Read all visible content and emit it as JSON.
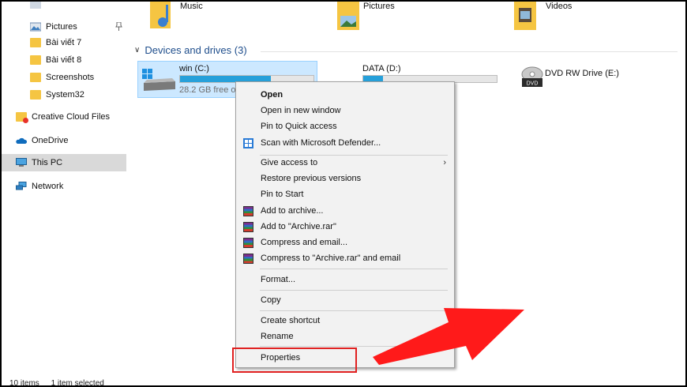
{
  "sidebar": {
    "items": [
      {
        "label": "Pictures",
        "pinned": true
      },
      {
        "label": "Bài viết 7"
      },
      {
        "label": "Bài viết 8"
      },
      {
        "label": "Screenshots"
      },
      {
        "label": "System32"
      },
      {
        "label": "Creative Cloud Files"
      },
      {
        "label": "OneDrive"
      },
      {
        "label": "This PC",
        "selected": true
      },
      {
        "label": "Network"
      }
    ]
  },
  "folders": [
    {
      "label": "Music"
    },
    {
      "label": "Pictures"
    },
    {
      "label": "Videos"
    }
  ],
  "group": {
    "label": "Devices and drives (3)"
  },
  "drives": [
    {
      "name": "win (C:)",
      "free_text": "28.2 GB free of",
      "used_fraction": 0.68
    },
    {
      "name": "DATA (D:)",
      "used_fraction": 0.15
    },
    {
      "name": "DVD RW Drive (E:)",
      "badge": "DVD"
    }
  ],
  "context_menu": {
    "items": [
      {
        "label": "Open",
        "bold": true
      },
      {
        "label": "Open in new window"
      },
      {
        "label": "Pin to Quick access"
      },
      {
        "label": "Scan with Microsoft Defender...",
        "icon": "defender-icon"
      },
      {
        "label": "Give access to",
        "submenu": true
      },
      {
        "label": "Restore previous versions"
      },
      {
        "label": "Pin to Start"
      },
      {
        "label": "Add to archive...",
        "icon": "winrar-icon"
      },
      {
        "label": "Add to \"Archive.rar\"",
        "icon": "winrar-icon"
      },
      {
        "label": "Compress and email...",
        "icon": "winrar-icon"
      },
      {
        "label": "Compress to \"Archive.rar\" and email",
        "icon": "winrar-icon"
      },
      {
        "label": "Format..."
      },
      {
        "label": "Copy"
      },
      {
        "label": "Create shortcut"
      },
      {
        "label": "Rename"
      },
      {
        "label": "Properties"
      }
    ],
    "submenu_glyph": "›"
  },
  "status_bar": {
    "items": "10 items",
    "selected": "1 item selected"
  },
  "annotation": {
    "highlight_color": "#e02020",
    "arrow_color": "#ff1a1a"
  },
  "colors": {
    "selection": "#cce8ff",
    "bar_fill": "#26a0da",
    "group_header": "#1f4e8c"
  }
}
